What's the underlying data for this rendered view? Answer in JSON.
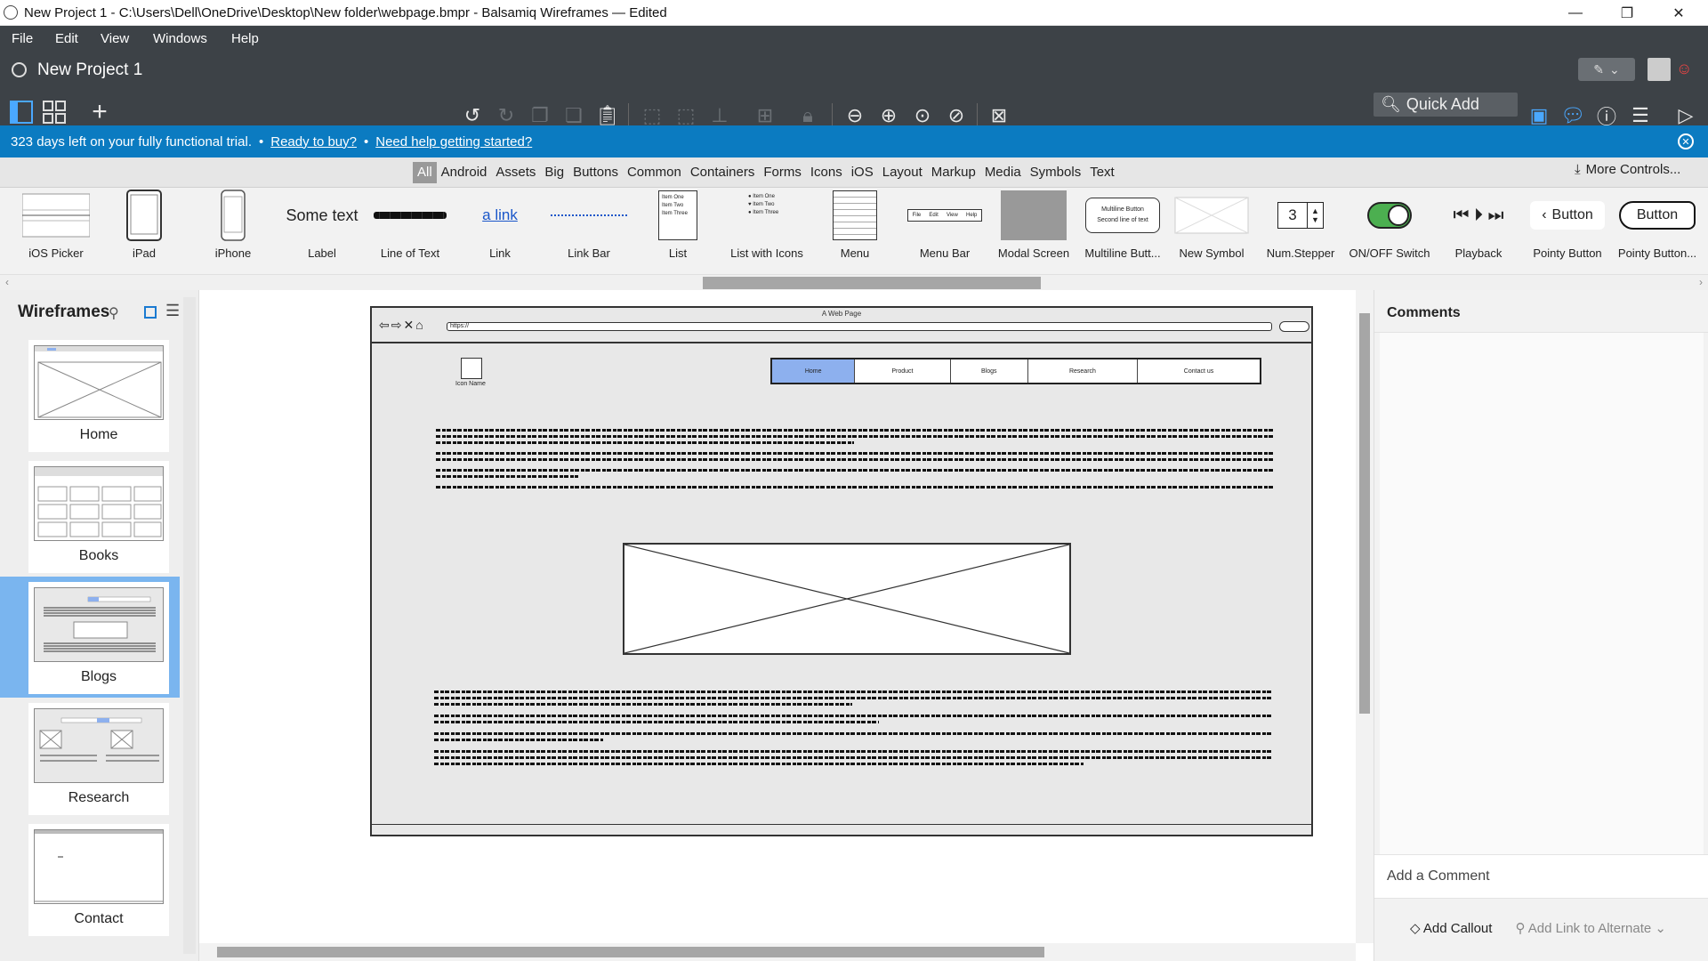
{
  "window": {
    "title": "New Project 1 - C:\\Users\\Dell\\OneDrive\\Desktop\\New folder\\webpage.bmpr - Balsamiq Wireframes — Edited",
    "min": "—",
    "max": "❐",
    "close": "✕"
  },
  "menubar": [
    "File",
    "Edit",
    "View",
    "Windows",
    "Help"
  ],
  "project": {
    "title": "New Project 1"
  },
  "quick_add": {
    "placeholder": "Quick Add"
  },
  "banner": {
    "text": "323 days left on your fully functional trial.",
    "sep1": "•",
    "link1": "Ready to buy?",
    "sep2": "•",
    "link2": "Need help getting started?"
  },
  "categories": [
    "All",
    "Android",
    "Assets",
    "Big",
    "Buttons",
    "Common",
    "Containers",
    "Forms",
    "Icons",
    "iOS",
    "Layout",
    "Markup",
    "Media",
    "Symbols",
    "Text"
  ],
  "more_controls": "More Controls...",
  "controls": [
    {
      "label": "iOS Picker"
    },
    {
      "label": "iPad"
    },
    {
      "label": "iPhone"
    },
    {
      "label": "Label",
      "sample": "Some text"
    },
    {
      "label": "Line of Text"
    },
    {
      "label": "Link",
      "sample": "a link"
    },
    {
      "label": "Link Bar"
    },
    {
      "label": "List",
      "items": [
        "Item One",
        "Item Two",
        "Item Three"
      ]
    },
    {
      "label": "List with Icons",
      "items": [
        "Item One",
        "Item Two",
        "Item Three"
      ]
    },
    {
      "label": "Menu"
    },
    {
      "label": "Menu Bar",
      "items": [
        "File",
        "Edit",
        "View",
        "Help"
      ]
    },
    {
      "label": "Modal Screen"
    },
    {
      "label": "Multiline Butt...",
      "line1": "Multiline Button",
      "line2": "Second line of text"
    },
    {
      "label": "New Symbol"
    },
    {
      "label": "Num.Stepper",
      "value": "3"
    },
    {
      "label": "ON/OFF Switch"
    },
    {
      "label": "Playback"
    },
    {
      "label": "Pointy Button",
      "sample": "Button"
    },
    {
      "label": "Pointy Button...",
      "sample": "Button"
    }
  ],
  "pages_panel": {
    "title": "Wireframes",
    "pages": [
      "Home",
      "Books",
      "Blogs",
      "Research",
      "Contact"
    ],
    "selected": "Blogs"
  },
  "wireframe": {
    "caption": "A Web Page",
    "url": "https://",
    "logo_label": "Icon Name",
    "menu": [
      "Home",
      "Product",
      "Blogs",
      "Research",
      "Contact us"
    ],
    "active_menu": "Home"
  },
  "comments": {
    "title": "Comments",
    "add_comment": "Add a Comment",
    "add_callout": "Add Callout",
    "add_link": "Add Link to Alternate"
  },
  "colors": {
    "titlebar_dark": "#3d4247",
    "banner": "#0b7bc1",
    "selection": "#7ab5ef",
    "switch_green": "#4caf50",
    "active_menu": "#8db0ee"
  }
}
